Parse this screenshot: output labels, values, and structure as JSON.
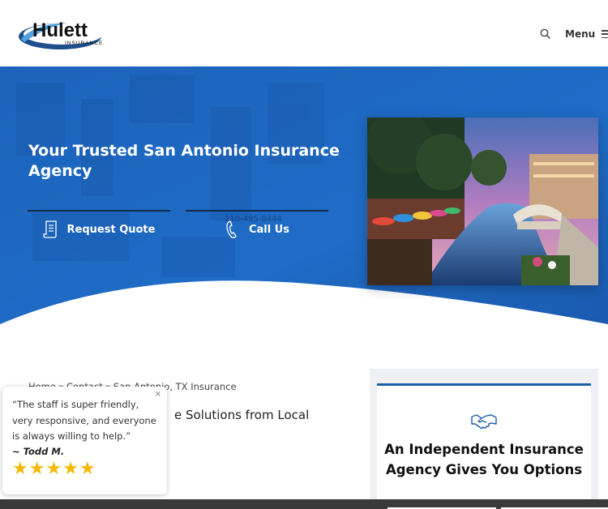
{
  "header": {
    "logo_text": "Hulett",
    "logo_subtext": "INSURANCE",
    "search_icon": "search-icon",
    "menu_label": "Menu",
    "menu_icon": "hamburger-icon"
  },
  "hero": {
    "title": "Your Trusted San Antonio Insurance Agency",
    "request_quote_label": "Request Quote",
    "request_quote_icon": "document-icon",
    "call_us_label": "Call Us",
    "call_us_icon": "phone-icon",
    "phone_text": "210-495-8444",
    "photo": "san-antonio-riverwalk-photo",
    "background_color": "#1f68c0"
  },
  "breadcrumb": {
    "items": [
      "Home",
      "Contact",
      "San Antonio, TX Insurance"
    ],
    "separator": "»"
  },
  "content": {
    "heading_visible": "e Solutions from Local"
  },
  "review": {
    "close_label": "×",
    "quote": "“The staff is super friendly, very responsive, and everyone is always willing to help.”",
    "author": "~ Todd M.",
    "rating": 5,
    "star_glyph": "★",
    "star_color": "#f5b800"
  },
  "sidebar": {
    "icon": "handshake-icon",
    "title": "An Independent Insurance Agency Gives You Options",
    "accent_color": "#1f5fa8"
  }
}
